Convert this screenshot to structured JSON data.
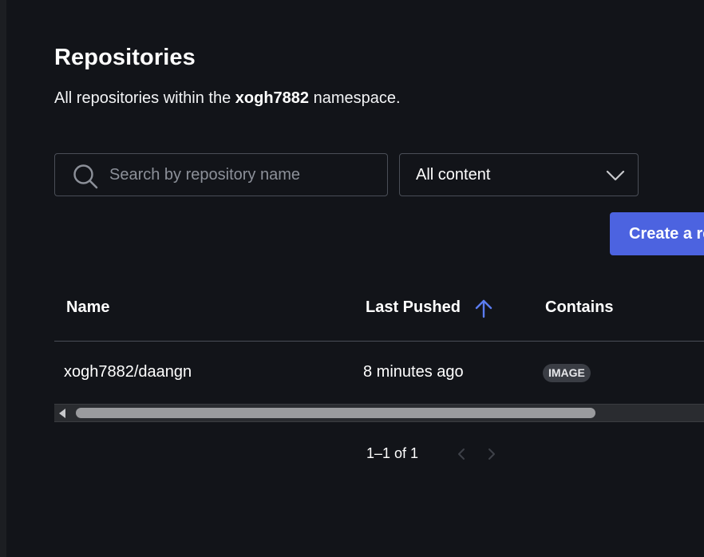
{
  "header": {
    "title": "Repositories",
    "subtitle_prefix": "All repositories within the ",
    "namespace": "xogh7882",
    "subtitle_suffix": " namespace."
  },
  "filters": {
    "search_placeholder": "Search by repository name",
    "search_value": "",
    "content_select": {
      "selected": "All content"
    }
  },
  "actions": {
    "create_label": "Create a repository"
  },
  "table": {
    "columns": {
      "name": "Name",
      "last_pushed": "Last Pushed",
      "contains": "Contains"
    },
    "sort": {
      "column": "last_pushed",
      "direction": "ascending"
    },
    "rows": [
      {
        "name": "xogh7882/daangn",
        "last_pushed": "8 minutes ago",
        "contains": "IMAGE"
      }
    ]
  },
  "pagination": {
    "range_text": "1–1 of 1"
  },
  "colors": {
    "background": "#121419",
    "accent": "#4c63e0",
    "sort_arrow": "#5b7cf0",
    "border": "#4a4e57"
  },
  "icons": {
    "search": "search-icon",
    "dropdown": "chevron-down-icon",
    "sort": "arrow-up-icon",
    "prev": "chevron-left-icon",
    "next": "chevron-right-icon"
  }
}
